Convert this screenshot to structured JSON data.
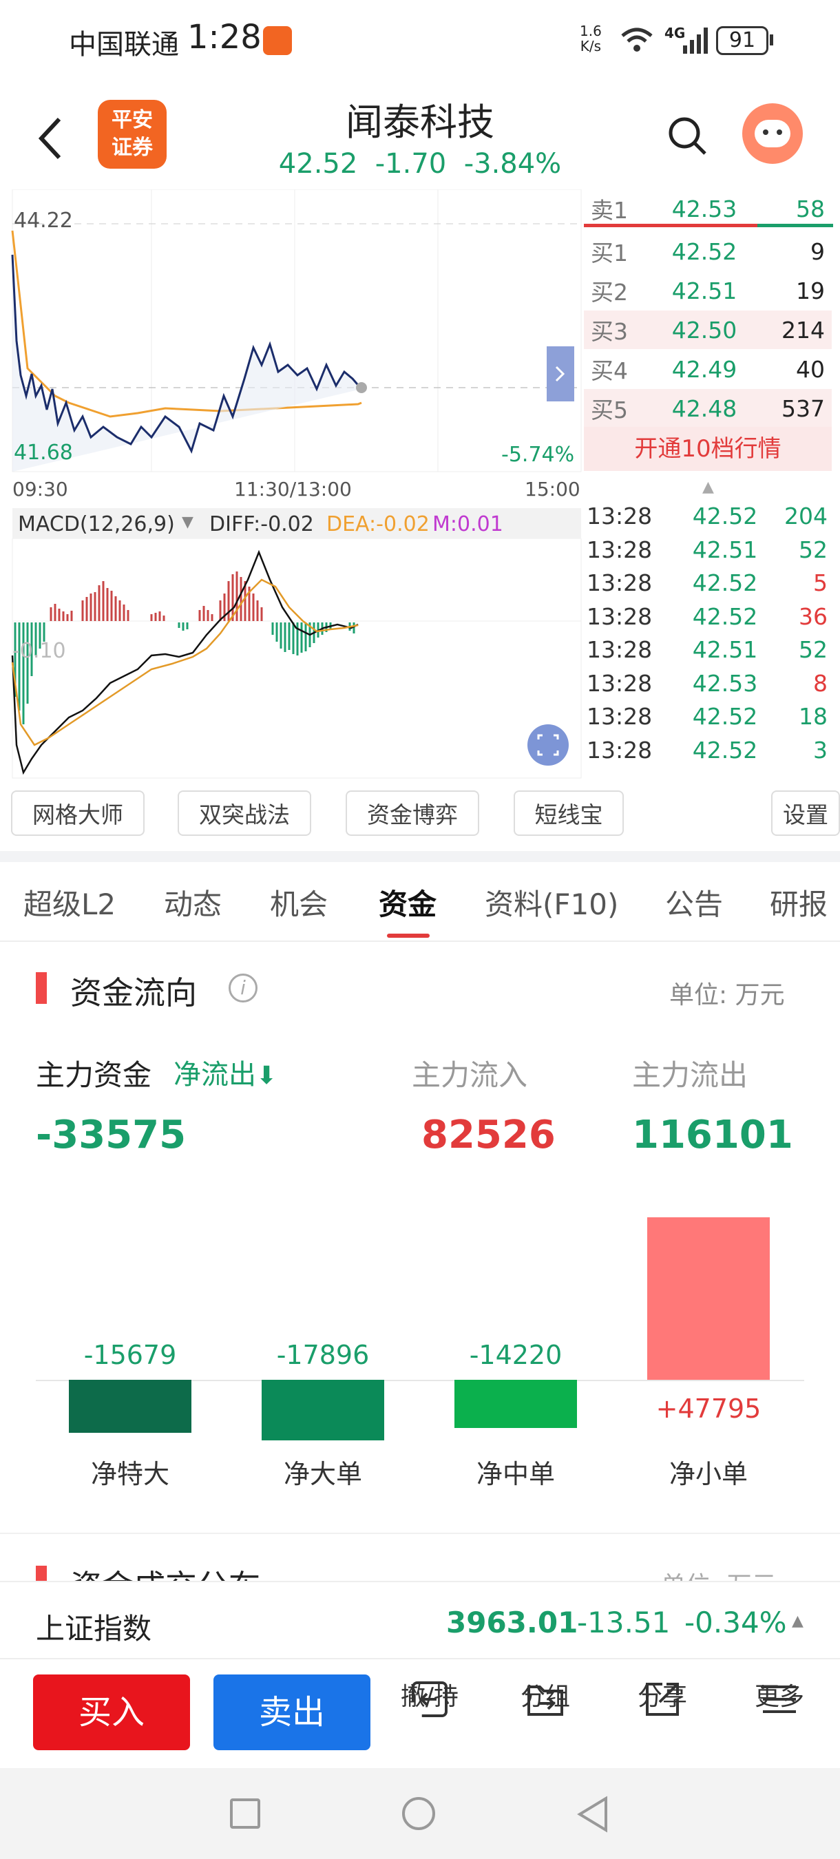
{
  "status": {
    "carrier": "中国联通",
    "time": "1:28",
    "speed_top": "1.6",
    "speed_bottom": "K/s",
    "net": "4G",
    "battery": "91"
  },
  "header": {
    "back": "back",
    "logo_line1": "平安",
    "logo_line2": "证券",
    "title": "闻泰科技",
    "price": "42.52",
    "change": "-1.70",
    "pct": "-3.84%"
  },
  "chart": {
    "top_price": "44.22",
    "low_price": "41.68",
    "low_pct": "-5.74%",
    "times": [
      "09:30",
      "11:30/13:00",
      "15:00"
    ],
    "macd_label": "MACD(12,26,9)",
    "diff": "DIFF:-0.02",
    "dea": "DEA:-0.02",
    "m": "M:0.01",
    "macd_axis": "-0.10"
  },
  "orderbook": [
    {
      "label": "卖1",
      "price": "42.53",
      "vol": "58",
      "volcolor": "#1a9e6a"
    },
    {
      "label": "买1",
      "price": "42.52",
      "vol": "9",
      "volcolor": "#222"
    },
    {
      "label": "买2",
      "price": "42.51",
      "vol": "19",
      "volcolor": "#222"
    },
    {
      "label": "买3",
      "price": "42.50",
      "vol": "214",
      "volcolor": "#222"
    },
    {
      "label": "买4",
      "price": "42.49",
      "vol": "40",
      "volcolor": "#222"
    },
    {
      "label": "买5",
      "price": "42.48",
      "vol": "537",
      "volcolor": "#222"
    }
  ],
  "level10_banner": "开通10档行情",
  "ticks": [
    {
      "time": "13:28",
      "price": "42.52",
      "vol": "204",
      "color": "#1a9e6a"
    },
    {
      "time": "13:28",
      "price": "42.51",
      "vol": "52",
      "color": "#1a9e6a"
    },
    {
      "time": "13:28",
      "price": "42.52",
      "vol": "5",
      "color": "#e23b3b"
    },
    {
      "time": "13:28",
      "price": "42.52",
      "vol": "36",
      "color": "#e23b3b"
    },
    {
      "time": "13:28",
      "price": "42.51",
      "vol": "52",
      "color": "#1a9e6a"
    },
    {
      "time": "13:28",
      "price": "42.53",
      "vol": "8",
      "color": "#e23b3b"
    },
    {
      "time": "13:28",
      "price": "42.52",
      "vol": "18",
      "color": "#1a9e6a"
    },
    {
      "time": "13:28",
      "price": "42.52",
      "vol": "3",
      "color": "#1a9e6a"
    }
  ],
  "tools": [
    "网格大师",
    "双突战法",
    "资金博弈",
    "短线宝",
    "设置"
  ],
  "tabs": [
    "超级L2",
    "动态",
    "机会",
    "资金",
    "资料(F10)",
    "公告",
    "研报"
  ],
  "active_tab": "资金",
  "fund": {
    "title": "资金流向",
    "unit": "单位: 万元",
    "main_label": "主力资金",
    "net_label": "净流出",
    "inflow_label": "主力流入",
    "outflow_label": "主力流出",
    "main_value": "-33575",
    "inflow_value": "82526",
    "outflow_value": "116101"
  },
  "bars": [
    {
      "name": "净特大",
      "value": -15679,
      "label": "-15679",
      "color": "#0d6b4a"
    },
    {
      "name": "净大单",
      "value": -17896,
      "label": "-17896",
      "color": "#0b8a58"
    },
    {
      "name": "净中单",
      "value": -14220,
      "label": "-14220",
      "color": "#0bb04d"
    },
    {
      "name": "净小单",
      "value": 47795,
      "label": "+47795",
      "color": "#ff7878"
    }
  ],
  "next_section": {
    "title": "资金成交分布",
    "unit": "单位: 万元"
  },
  "index_bar": {
    "name": "上证指数",
    "value": "3963.01",
    "change": "-13.51",
    "pct": "-0.34%"
  },
  "toolbar": {
    "buy": "买入",
    "sell": "卖出",
    "items": [
      "撤/持",
      "分组",
      "分享",
      "更多"
    ]
  },
  "chart_data": {
    "type": "bar",
    "categories": [
      "净特大",
      "净大单",
      "净中单",
      "净小单"
    ],
    "values": [
      -15679,
      -17896,
      -14220,
      47795
    ],
    "unit": "万元"
  }
}
